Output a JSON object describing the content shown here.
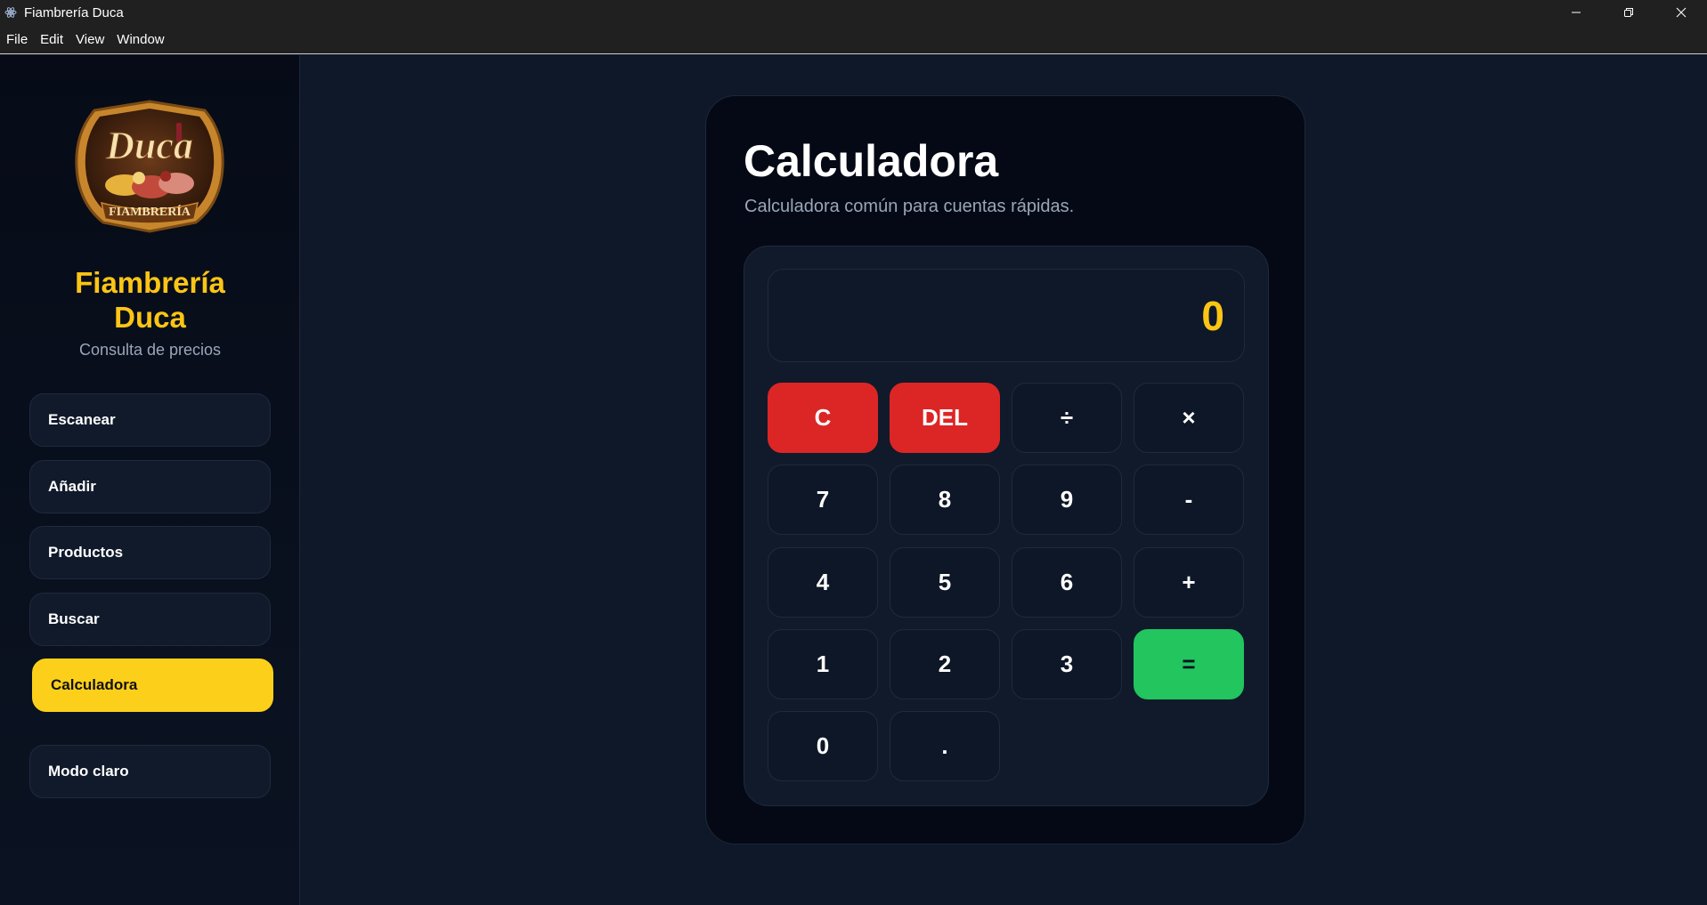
{
  "window": {
    "title": "Fiambrería Duca"
  },
  "menu": [
    "File",
    "Edit",
    "View",
    "Window"
  ],
  "sidebar": {
    "brand_line1": "Fiambrería",
    "brand_line2": "Duca",
    "subtitle": "Consulta de precios",
    "items": [
      {
        "label": "Escanear",
        "active": false
      },
      {
        "label": "Añadir",
        "active": false
      },
      {
        "label": "Productos",
        "active": false
      },
      {
        "label": "Buscar",
        "active": false
      },
      {
        "label": "Calculadora",
        "active": true
      }
    ],
    "theme_toggle": "Modo claro"
  },
  "main": {
    "title": "Calculadora",
    "subtitle": "Calculadora común para cuentas rápidas.",
    "display_value": "0",
    "keys": {
      "clear": "C",
      "delete": "DEL",
      "divide": "÷",
      "multiply": "×",
      "seven": "7",
      "eight": "8",
      "nine": "9",
      "minus": "-",
      "four": "4",
      "five": "5",
      "six": "6",
      "plus": "+",
      "one": "1",
      "two": "2",
      "three": "3",
      "equals": "=",
      "zero": "0",
      "decimal": "."
    }
  },
  "colors": {
    "accent": "#fac515",
    "danger": "#dc2626",
    "success": "#22c55e"
  }
}
